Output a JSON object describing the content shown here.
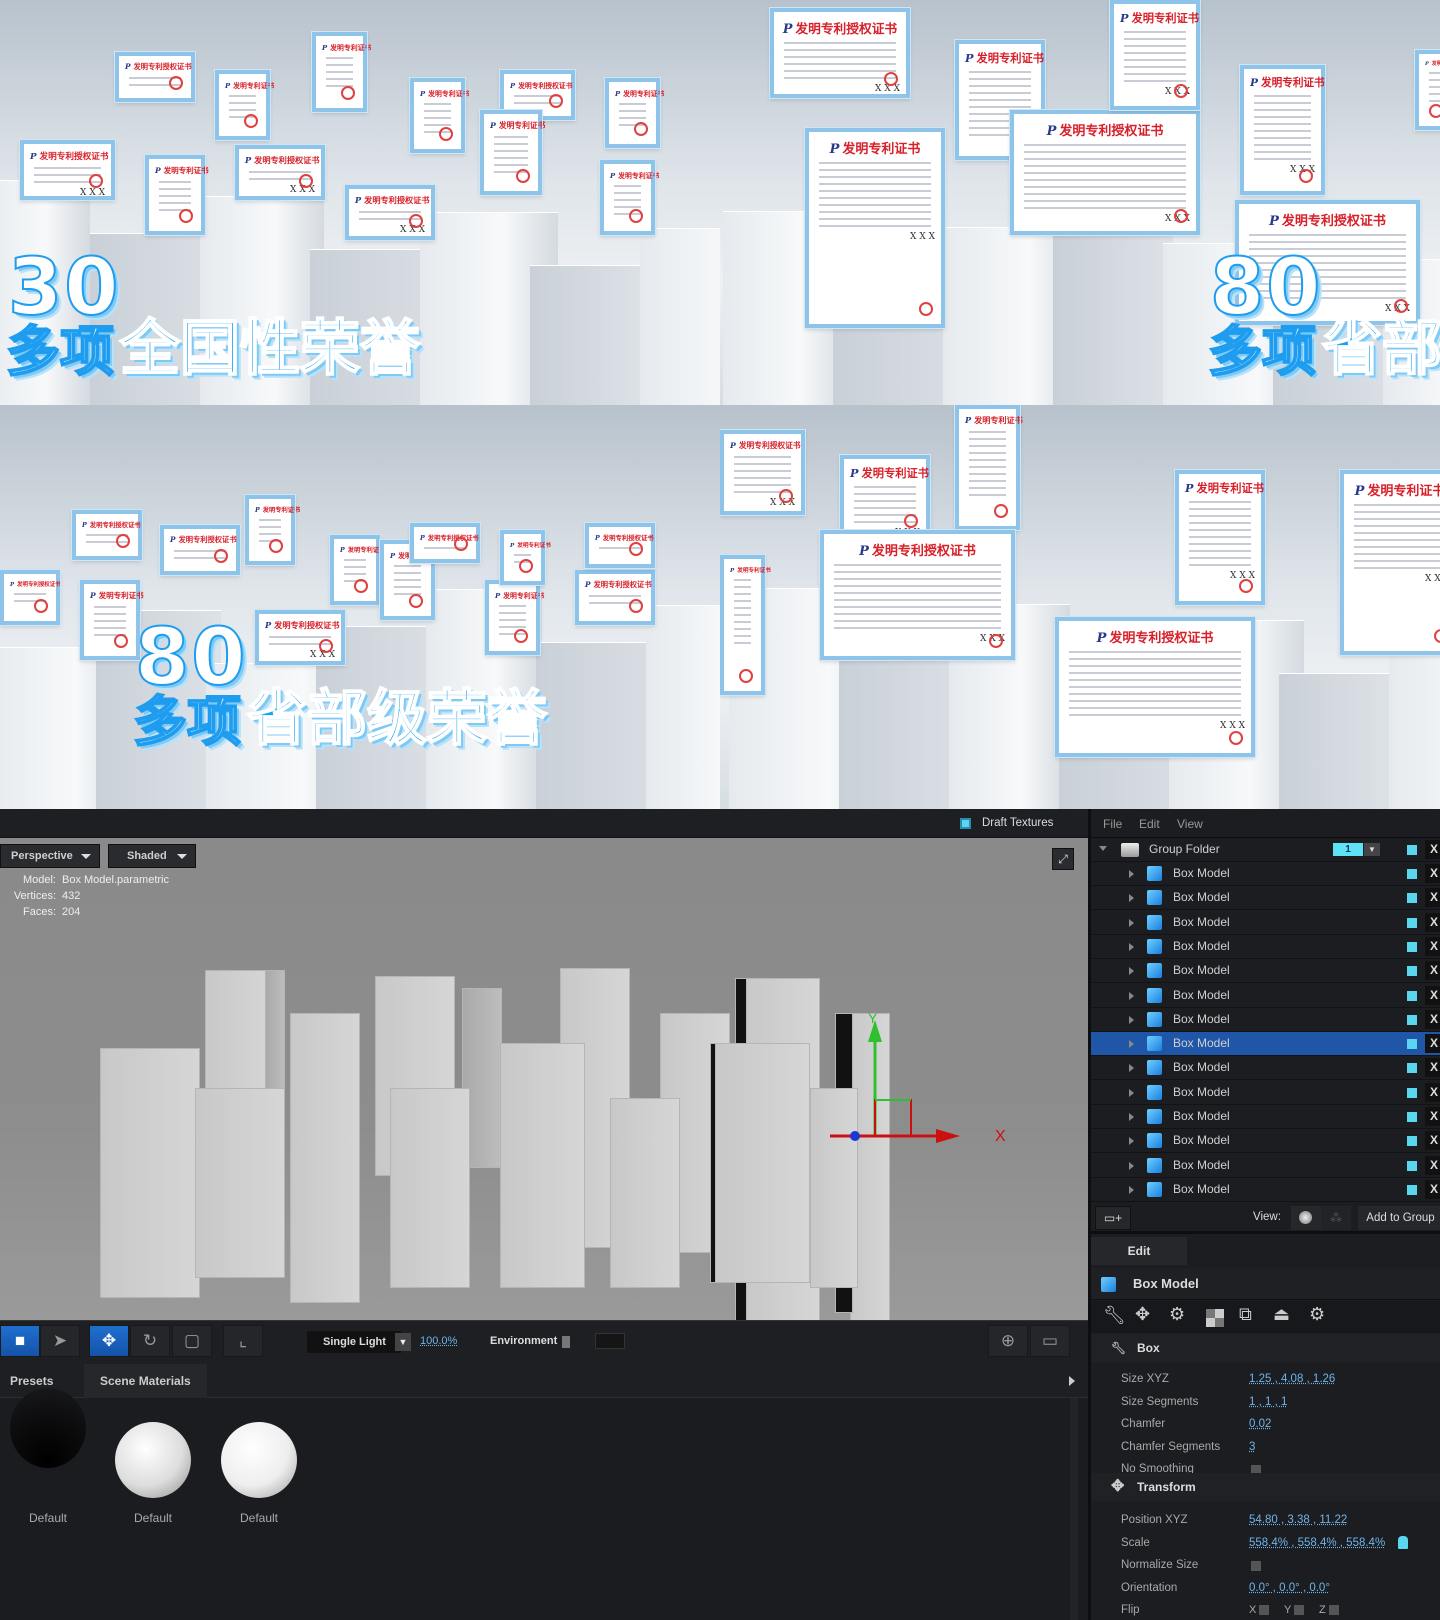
{
  "preview": {
    "quadrants": [
      {
        "number": "30",
        "caption_prefix": "多项",
        "caption_main": "全国性荣誉"
      },
      {
        "number": "80",
        "caption_prefix": "多项",
        "caption_main": "省部"
      },
      {
        "number": "80",
        "caption_prefix": "多项",
        "caption_main": "省部级荣誉"
      },
      {
        "number": "",
        "caption_prefix": "",
        "caption_main": ""
      }
    ],
    "cert_landscape_title": "发明专利授权证书",
    "cert_portrait_title": "发明专利证书",
    "cert_signature": "X X X"
  },
  "viewport": {
    "draft_textures_label": "Draft Textures",
    "draft_textures_checked": true,
    "camera_mode": "Perspective",
    "shading_mode": "Shaded",
    "info": {
      "model_label": "Model:",
      "model_value": "Box Model.parametric",
      "vertices_label": "Vertices:",
      "vertices_value": "432",
      "faces_label": "Faces:",
      "faces_value": "204"
    },
    "axis_x": "X",
    "axis_y": "Y"
  },
  "toolbar": {
    "tools": [
      "camera-icon",
      "select-arrow-icon",
      "move-icon",
      "rotate-icon",
      "scale-icon",
      "axis-icon"
    ],
    "active_tools": [
      "camera-icon",
      "move-icon"
    ],
    "lighting": "Single Light",
    "light_intensity": "100.0%",
    "environment_label": "Environment"
  },
  "materials": {
    "tabs": [
      "Presets",
      "Scene Materials"
    ],
    "active_tab": "Scene Materials",
    "items": [
      {
        "label": "Default",
        "tone": "black"
      },
      {
        "label": "Default",
        "tone": "white"
      },
      {
        "label": "Default",
        "tone": "bright"
      }
    ]
  },
  "scene_panel": {
    "menu": [
      "File",
      "Edit",
      "View"
    ],
    "group": {
      "label": "Group Folder",
      "index": "1"
    },
    "items": [
      "Box Model",
      "Box Model",
      "Box Model",
      "Box Model",
      "Box Model",
      "Box Model",
      "Box Model",
      "Box Model",
      "Box Model",
      "Box Model",
      "Box Model",
      "Box Model",
      "Box Model",
      "Box Model"
    ],
    "selected_index": 7,
    "view_label": "View:",
    "add_to_group": "Add to Group",
    "close_label": "X"
  },
  "edit_panel": {
    "tab": "Edit",
    "object_name": "Box Model",
    "box_section": "Box",
    "box_props": [
      {
        "label": "Size XYZ",
        "value": "1.25 ,  4.08 ,  1.26"
      },
      {
        "label": "Size Segments",
        "value": "1 ,  1 ,  1"
      },
      {
        "label": "Chamfer",
        "value": "0.02"
      },
      {
        "label": "Chamfer Segments",
        "value": "3"
      },
      {
        "label": "No Smoothing",
        "value": ""
      }
    ],
    "transform_section": "Transform",
    "transform_props": [
      {
        "label": "Position XYZ",
        "value": "54.80 ,  3.38 ,  11.22"
      },
      {
        "label": "Scale",
        "value": "558.4% ,  558.4% ,  558.4%"
      },
      {
        "label": "Normalize Size",
        "value": ""
      },
      {
        "label": "Orientation",
        "value": "0.0° ,  0.0° ,  0.0°"
      },
      {
        "label": "Flip",
        "value": ""
      }
    ],
    "flip_axes": [
      "X",
      "Y",
      "Z"
    ],
    "scale_locked": true
  }
}
